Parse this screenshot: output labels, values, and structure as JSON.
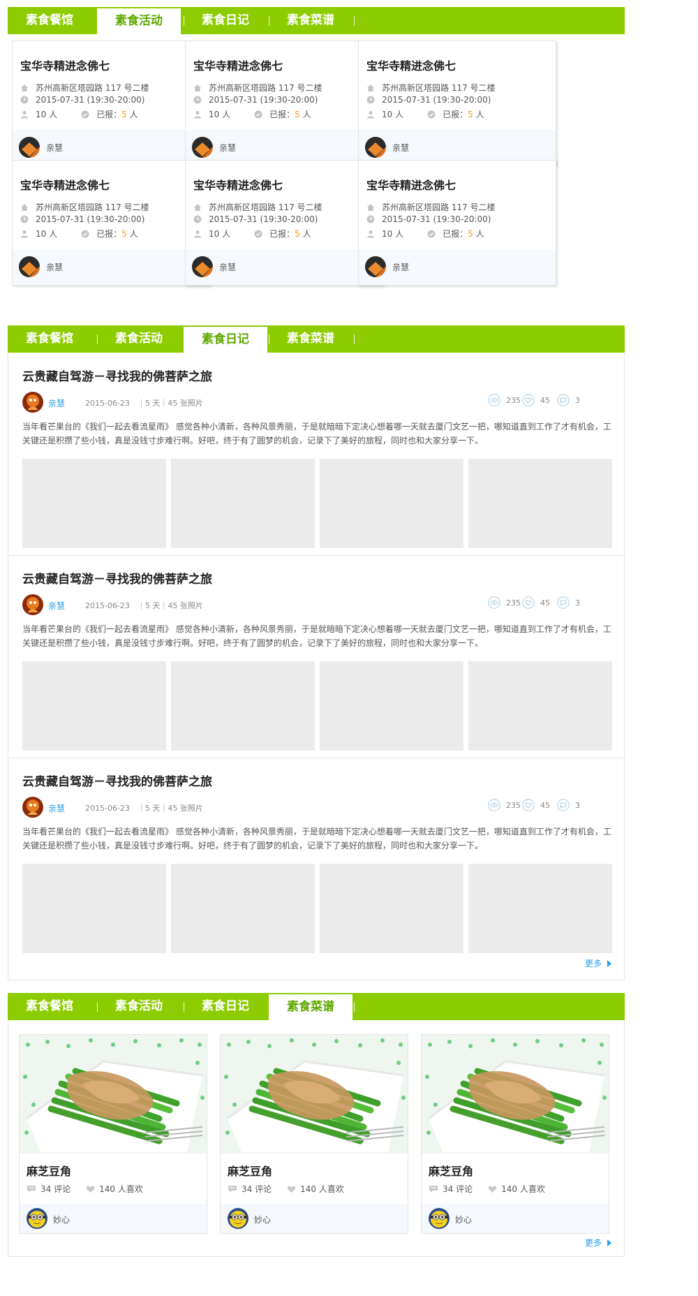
{
  "tabs": [
    "素食餐馆",
    "素食活动",
    "素食日记",
    "素食菜谱"
  ],
  "activities": [
    {
      "title": "宝华寺精进念佛七",
      "address": "苏州高新区塔园路 117 号二楼",
      "time": "2015-07-31 (19:30-20:00)",
      "capacity_count": "10",
      "capacity_unit": "人",
      "registered_label": "已报：",
      "registered_count": "5",
      "registered_unit": "人",
      "organizer": "亲慧"
    },
    {
      "title": "宝华寺精进念佛七",
      "address": "苏州高新区塔园路 117 号二楼",
      "time": "2015-07-31 (19:30-20:00)",
      "capacity_count": "10",
      "capacity_unit": "人",
      "registered_label": "已报：",
      "registered_count": "5",
      "registered_unit": "人",
      "organizer": "亲慧"
    },
    {
      "title": "宝华寺精进念佛七",
      "address": "苏州高新区塔园路 117 号二楼",
      "time": "2015-07-31 (19:30-20:00)",
      "capacity_count": "10",
      "capacity_unit": "人",
      "registered_label": "已报：",
      "registered_count": "5",
      "registered_unit": "人",
      "organizer": "亲慧"
    },
    {
      "title": "宝华寺精进念佛七",
      "address": "苏州高新区塔园路 117 号二楼",
      "time": "2015-07-31 (19:30-20:00)",
      "capacity_count": "10",
      "capacity_unit": "人",
      "registered_label": "已报：",
      "registered_count": "5",
      "registered_unit": "人",
      "organizer": "亲慧"
    },
    {
      "title": "宝华寺精进念佛七",
      "address": "苏州高新区塔园路 117 号二楼",
      "time": "2015-07-31 (19:30-20:00)",
      "capacity_count": "10",
      "capacity_unit": "人",
      "registered_label": "已报：",
      "registered_count": "5",
      "registered_unit": "人",
      "organizer": "亲慧"
    },
    {
      "title": "宝华寺精进念佛七",
      "address": "苏州高新区塔园路 117 号二楼",
      "time": "2015-07-31 (19:30-20:00)",
      "capacity_count": "10",
      "capacity_unit": "人",
      "registered_label": "已报：",
      "registered_count": "5",
      "registered_unit": "人",
      "organizer": "亲慧"
    }
  ],
  "diaries": [
    {
      "title": "云贵藏自驾游－寻找我的佛菩萨之旅",
      "author": "亲慧",
      "info": "2015-06-23　｜5 天｜45 张照片",
      "views": "235",
      "likes": "45",
      "comments": "3",
      "text": "当年看芒果台的《我们一起去看流星雨》 感觉各种小清新，各种风景秀丽，于是就暗暗下定决心想着哪一天就去厦门文艺一把，哪知道直到工作了才有机会，工关键还是积攒了些小钱，真是没钱寸步难行啊。好吧，终于有了圆梦的机会，记录下了美好的旅程，同时也和大家分享一下。"
    },
    {
      "title": "云贵藏自驾游－寻找我的佛菩萨之旅",
      "author": "亲慧",
      "info": "2015-06-23　｜5 天｜45 张照片",
      "views": "235",
      "likes": "45",
      "comments": "3",
      "text": "当年看芒果台的《我们一起去看流星雨》 感觉各种小清新，各种风景秀丽，于是就暗暗下定决心想着哪一天就去厦门文艺一把，哪知道直到工作了才有机会，工关键还是积攒了些小钱，真是没钱寸步难行啊。好吧，终于有了圆梦的机会，记录下了美好的旅程，同时也和大家分享一下。"
    },
    {
      "title": "云贵藏自驾游－寻找我的佛菩萨之旅",
      "author": "亲慧",
      "info": "2015-06-23　｜5 天｜45 张照片",
      "views": "235",
      "likes": "45",
      "comments": "3",
      "text": "当年看芒果台的《我们一起去看流星雨》 感觉各种小清新，各种风景秀丽，于是就暗暗下定决心想着哪一天就去厦门文艺一把，哪知道直到工作了才有机会，工关键还是积攒了些小钱，真是没钱寸步难行啊。好吧，终于有了圆梦的机会，记录下了美好的旅程，同时也和大家分享一下。"
    }
  ],
  "more_label": "更多",
  "recipes": [
    {
      "title": "麻芝豆角",
      "comments": "34 评论",
      "likes": "140 人喜欢",
      "author": "妙心"
    },
    {
      "title": "麻芝豆角",
      "comments": "34 评论",
      "likes": "140 人喜欢",
      "author": "妙心"
    },
    {
      "title": "麻芝豆角",
      "comments": "34 评论",
      "likes": "140 人喜欢",
      "author": "妙心"
    }
  ],
  "colors": {
    "brand_green": "#8dcc00",
    "active_tab_text": "#5fa800",
    "link_blue": "#2a9be8",
    "highlight_orange": "#f29a1b"
  }
}
